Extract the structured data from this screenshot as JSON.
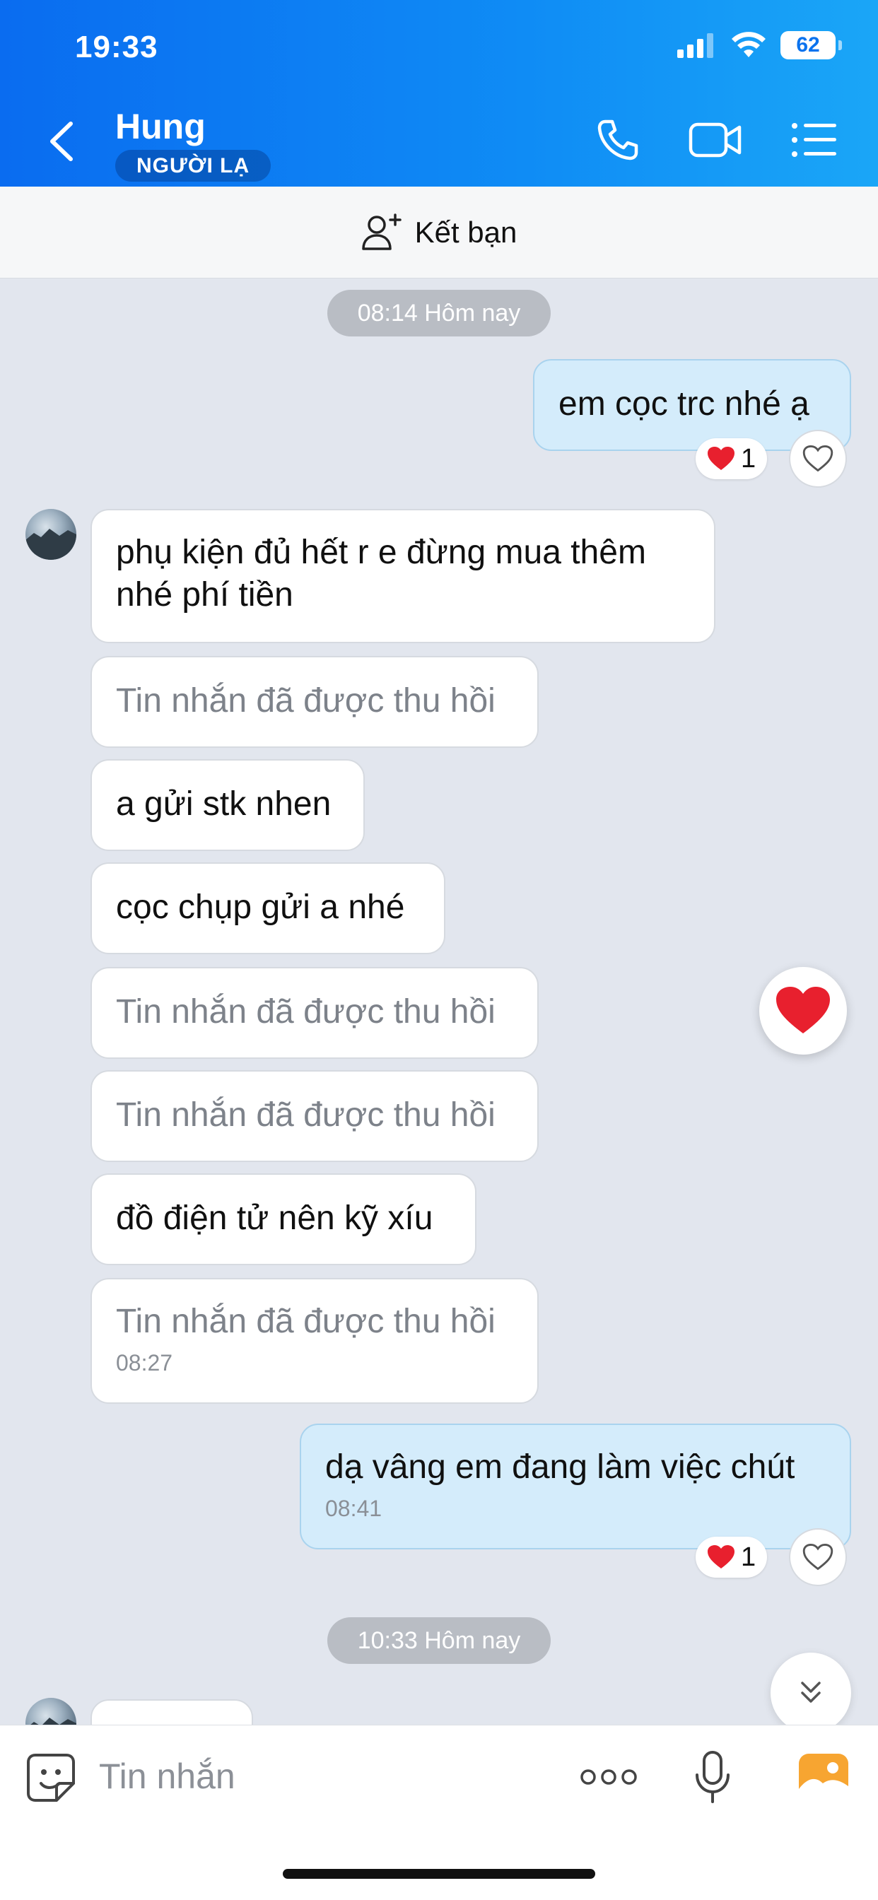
{
  "status_bar": {
    "time": "19:33",
    "battery": "62"
  },
  "header": {
    "contact_name": "Hung",
    "badge": "NGƯỜI LẠ"
  },
  "friend_bar": {
    "label": "Kết bạn"
  },
  "timestamps": {
    "first": "08:14 Hôm nay",
    "second": "10:33 Hôm nay"
  },
  "messages": [
    {
      "dir": "out",
      "text": "em cọc trc nhé ạ",
      "reaction_count": "1"
    },
    {
      "dir": "in",
      "line1": "phụ kiện đủ hết r e đừng mua thêm",
      "line2": "nhé phí tiền"
    },
    {
      "dir": "in",
      "text": "Tin nhắn đã được thu hồi"
    },
    {
      "dir": "in",
      "text": "a gửi stk nhen"
    },
    {
      "dir": "in",
      "text": "cọc chụp gửi a nhé"
    },
    {
      "dir": "in",
      "text": "Tin nhắn đã được thu hồi"
    },
    {
      "dir": "in",
      "text": "Tin nhắn đã được thu hồi"
    },
    {
      "dir": "in",
      "text": "đồ điện tử nên kỹ xíu"
    },
    {
      "dir": "in",
      "text": "Tin nhắn đã được thu hồi",
      "time": "08:27"
    },
    {
      "dir": "out",
      "text": "dạ vâng em đang làm việc chút",
      "time": "08:41",
      "reaction_count": "1"
    }
  ],
  "input": {
    "placeholder": "Tin nhắn"
  },
  "colors": {
    "header_start": "#0a6cf0",
    "header_end": "#1aa6f7",
    "outgoing_bubble": "#d4ecfb",
    "heart": "#e8202e"
  }
}
